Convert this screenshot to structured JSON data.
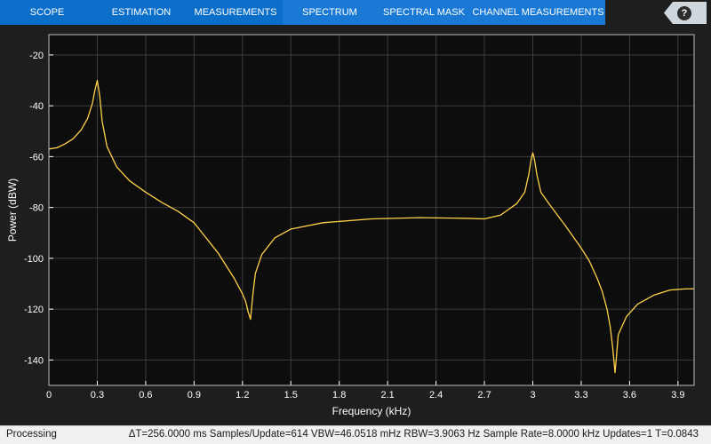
{
  "toolstrip": {
    "tabs": [
      {
        "label": "SCOPE",
        "active": false
      },
      {
        "label": "ESTIMATION",
        "active": false
      },
      {
        "label": "MEASUREMENTS",
        "active": false
      },
      {
        "label": "SPECTRUM",
        "active": true
      },
      {
        "label": "SPECTRAL MASK",
        "active": true
      },
      {
        "label": "CHANNEL MEASUREMENTS",
        "active": true
      }
    ],
    "help_label": "?"
  },
  "colors": {
    "toolstrip": "#0b6ec9",
    "toolstrip_active": "#1979d4",
    "plot_background": "#0d0d0d",
    "figure_background": "#1e1e1e",
    "trace": "#ffd24a",
    "grid": "#3c3c3c",
    "axis_text": "#ffffff"
  },
  "chart_data": {
    "type": "line",
    "xlabel": "Frequency (kHz)",
    "ylabel": "Power (dBW)",
    "xlim": [
      0,
      4.0
    ],
    "ylim": [
      -150,
      -12
    ],
    "grid": true,
    "x_ticks": [
      0,
      0.3,
      0.6,
      0.9,
      1.2,
      1.5,
      1.8,
      2.1,
      2.4,
      2.7,
      3.0,
      3.3,
      3.6,
      3.9
    ],
    "x_tick_labels": [
      "0",
      "0.3",
      "0.6",
      "0.9",
      "1.2",
      "1.5",
      "1.8",
      "2.1",
      "2.4",
      "2.7",
      "3",
      "3.3",
      "3.6",
      "3.9"
    ],
    "y_ticks": [
      -20,
      -40,
      -60,
      -80,
      -100,
      -120,
      -140
    ],
    "y_tick_labels": [
      "-20",
      "-40",
      "-60",
      "-80",
      "-100",
      "-120",
      "-140"
    ],
    "series": [
      {
        "x": [
          0,
          0.05,
          0.1,
          0.15,
          0.2,
          0.24,
          0.27,
          0.285,
          0.3,
          0.315,
          0.33,
          0.36,
          0.42,
          0.5,
          0.6,
          0.7,
          0.8,
          0.9,
          0.95,
          1.0,
          1.05,
          1.1,
          1.15,
          1.2,
          1.22,
          1.235,
          1.25,
          1.265,
          1.28,
          1.32,
          1.4,
          1.5,
          1.7,
          2.0,
          2.3,
          2.5,
          2.6,
          2.7,
          2.8,
          2.9,
          2.95,
          2.975,
          2.99,
          3.0,
          3.01,
          3.025,
          3.05,
          3.1,
          3.2,
          3.3,
          3.35,
          3.4,
          3.43,
          3.46,
          3.48,
          3.495,
          3.51,
          3.53,
          3.58,
          3.65,
          3.75,
          3.85,
          3.95,
          4.0
        ],
        "y": [
          -57,
          -56.5,
          -55,
          -53,
          -49.5,
          -45,
          -39,
          -34,
          -30,
          -36,
          -46,
          -56,
          -64,
          -69.5,
          -74,
          -78,
          -81.5,
          -86,
          -90,
          -94,
          -98,
          -103,
          -108,
          -114,
          -117,
          -121,
          -124,
          -114,
          -106,
          -98.5,
          -92,
          -88.5,
          -86,
          -84.5,
          -84,
          -84.2,
          -84.3,
          -84.5,
          -83,
          -78.5,
          -74,
          -67,
          -61,
          -58.5,
          -61,
          -67,
          -74,
          -78.5,
          -87,
          -96,
          -101,
          -108,
          -113,
          -120,
          -127,
          -135,
          -145,
          -130,
          -123,
          -118,
          -114.5,
          -112.5,
          -112,
          -112
        ]
      }
    ]
  },
  "status": {
    "processing": "Processing",
    "measures": "ΔT=256.0000 ms  Samples/Update=614  VBW=46.0518 mHz  RBW=3.9063 Hz  Sample Rate=8.0000 kHz  Updates=1  T=0.0843"
  }
}
